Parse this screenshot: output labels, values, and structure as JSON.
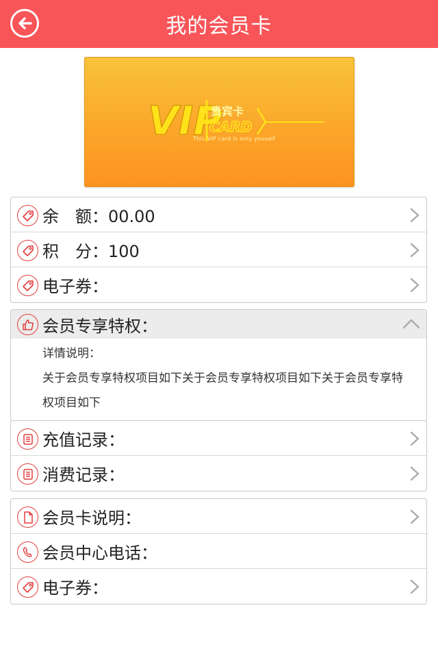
{
  "header": {
    "title": "我的会员卡"
  },
  "vip_card": {
    "logo_text": "VIP",
    "badge_text": "贵宾卡",
    "card_text": "CARD",
    "caption": "This VIP card is only youself"
  },
  "account": [
    {
      "label": "余　额：00.00"
    },
    {
      "label": "积　分：100"
    },
    {
      "label": "电子券："
    }
  ],
  "privileges": {
    "title": "会员专享特权：",
    "detail_label": "详情说明：",
    "detail_text": "关于会员专享特权项目如下关于会员专享特权项目如下关于会员专享特权项目如下"
  },
  "records": [
    {
      "label": "充值记录："
    },
    {
      "label": "消费记录："
    }
  ],
  "info": [
    {
      "label": "会员卡说明："
    },
    {
      "label": "会员中心电话："
    },
    {
      "label": "电子券："
    }
  ],
  "icons": {
    "back": "back-arrow-icon",
    "tag": "tag-icon",
    "thumb": "thumbs-up-icon",
    "list": "list-icon",
    "document": "document-icon",
    "phone": "phone-icon",
    "chevron_right": "chevron-right-icon",
    "chevron_up": "chevron-up-icon"
  },
  "colors": {
    "header": "#f85559",
    "icon_accent": "#e23c3c",
    "card_top": "#f7c33a",
    "card_bottom": "#fd9320",
    "logo_gold": "#ffe21a"
  }
}
